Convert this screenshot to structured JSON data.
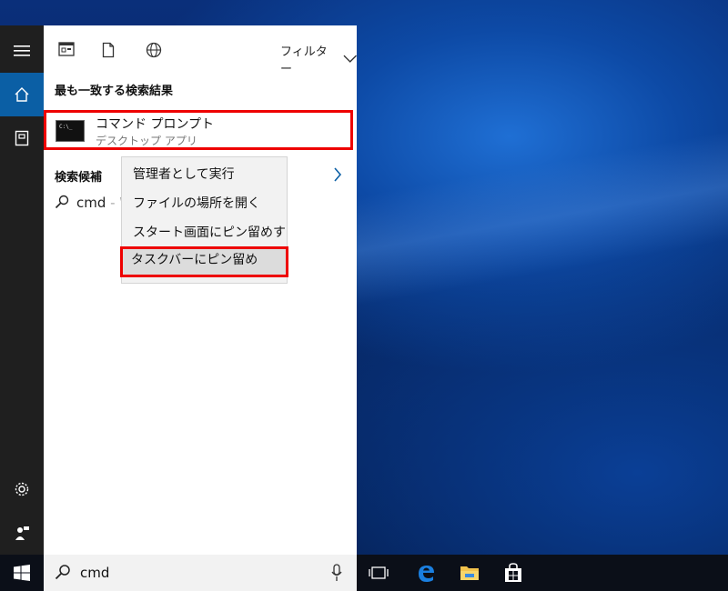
{
  "topbar": {
    "icons": [
      "apps-icon",
      "document-icon",
      "web-icon"
    ],
    "filter_label": "フィルター"
  },
  "best_match": {
    "header": "最も一致する検索結果",
    "title": "コマンド プロンプト",
    "subtitle": "デスクトップ アプリ"
  },
  "suggestions": {
    "header": "検索候補",
    "items": [
      {
        "text": "cmd",
        "hint": " - W"
      }
    ]
  },
  "context_menu": {
    "items": [
      {
        "label": "管理者として実行"
      },
      {
        "label": "ファイルの場所を開く"
      },
      {
        "label": "スタート画面にピン留めする"
      },
      {
        "label": "タスクバーにピン留め",
        "highlighted": true
      }
    ]
  },
  "searchbox": {
    "value": "cmd"
  },
  "colors": {
    "accent": "#0b5fa5",
    "highlight_border": "#e00000",
    "rail_bg": "#1f1f1f",
    "taskbar_bg": "#0b0f18"
  },
  "taskbar": {
    "icons": [
      "windows-start-icon",
      "task-view-icon",
      "edge-icon",
      "file-explorer-icon",
      "store-icon"
    ]
  }
}
